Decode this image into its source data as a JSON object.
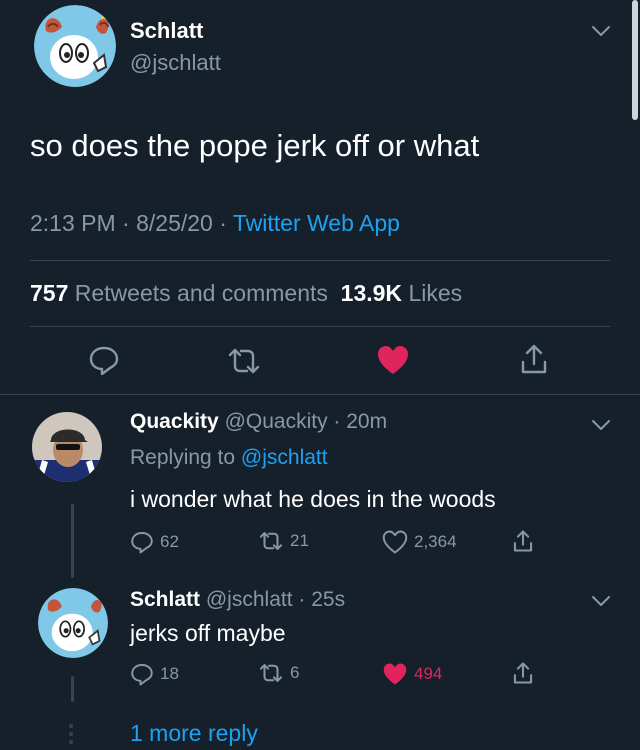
{
  "colors": {
    "background": "#15202b",
    "text": "#ffffff",
    "muted": "#8899a6",
    "accent_blue": "#1da1f2",
    "like_pink": "#e0245e",
    "divider": "#38444d"
  },
  "main_tweet": {
    "display_name": "Schlatt",
    "handle": "@jschlatt",
    "text": "so does the pope jerk off or what",
    "time": "2:13 PM",
    "date": "8/25/20",
    "source": "Twitter Web App",
    "retweets_count": "757",
    "retweets_label": "Retweets and comments",
    "likes_count": "13.9K",
    "likes_label": "Likes",
    "liked": true
  },
  "replies": [
    {
      "display_name": "Quackity",
      "handle": "@Quackity",
      "age": "20m",
      "replying_to_prefix": "Replying to",
      "replying_to_handle": "@jschlatt",
      "text": "i wonder what he does in the woods",
      "reply_count": "62",
      "retweet_count": "21",
      "like_count": "2,364",
      "liked": false
    },
    {
      "display_name": "Schlatt",
      "handle": "@jschlatt",
      "age": "25s",
      "text": "jerks off maybe",
      "reply_count": "18",
      "retweet_count": "6",
      "like_count": "494",
      "liked": true
    }
  ],
  "more_replies": {
    "label": "1 more reply"
  },
  "icons": {
    "reply": "reply-icon",
    "retweet": "retweet-icon",
    "like": "heart-icon",
    "share": "share-icon",
    "menu": "chevron-down-icon",
    "more": "vertical-dots-icon"
  }
}
